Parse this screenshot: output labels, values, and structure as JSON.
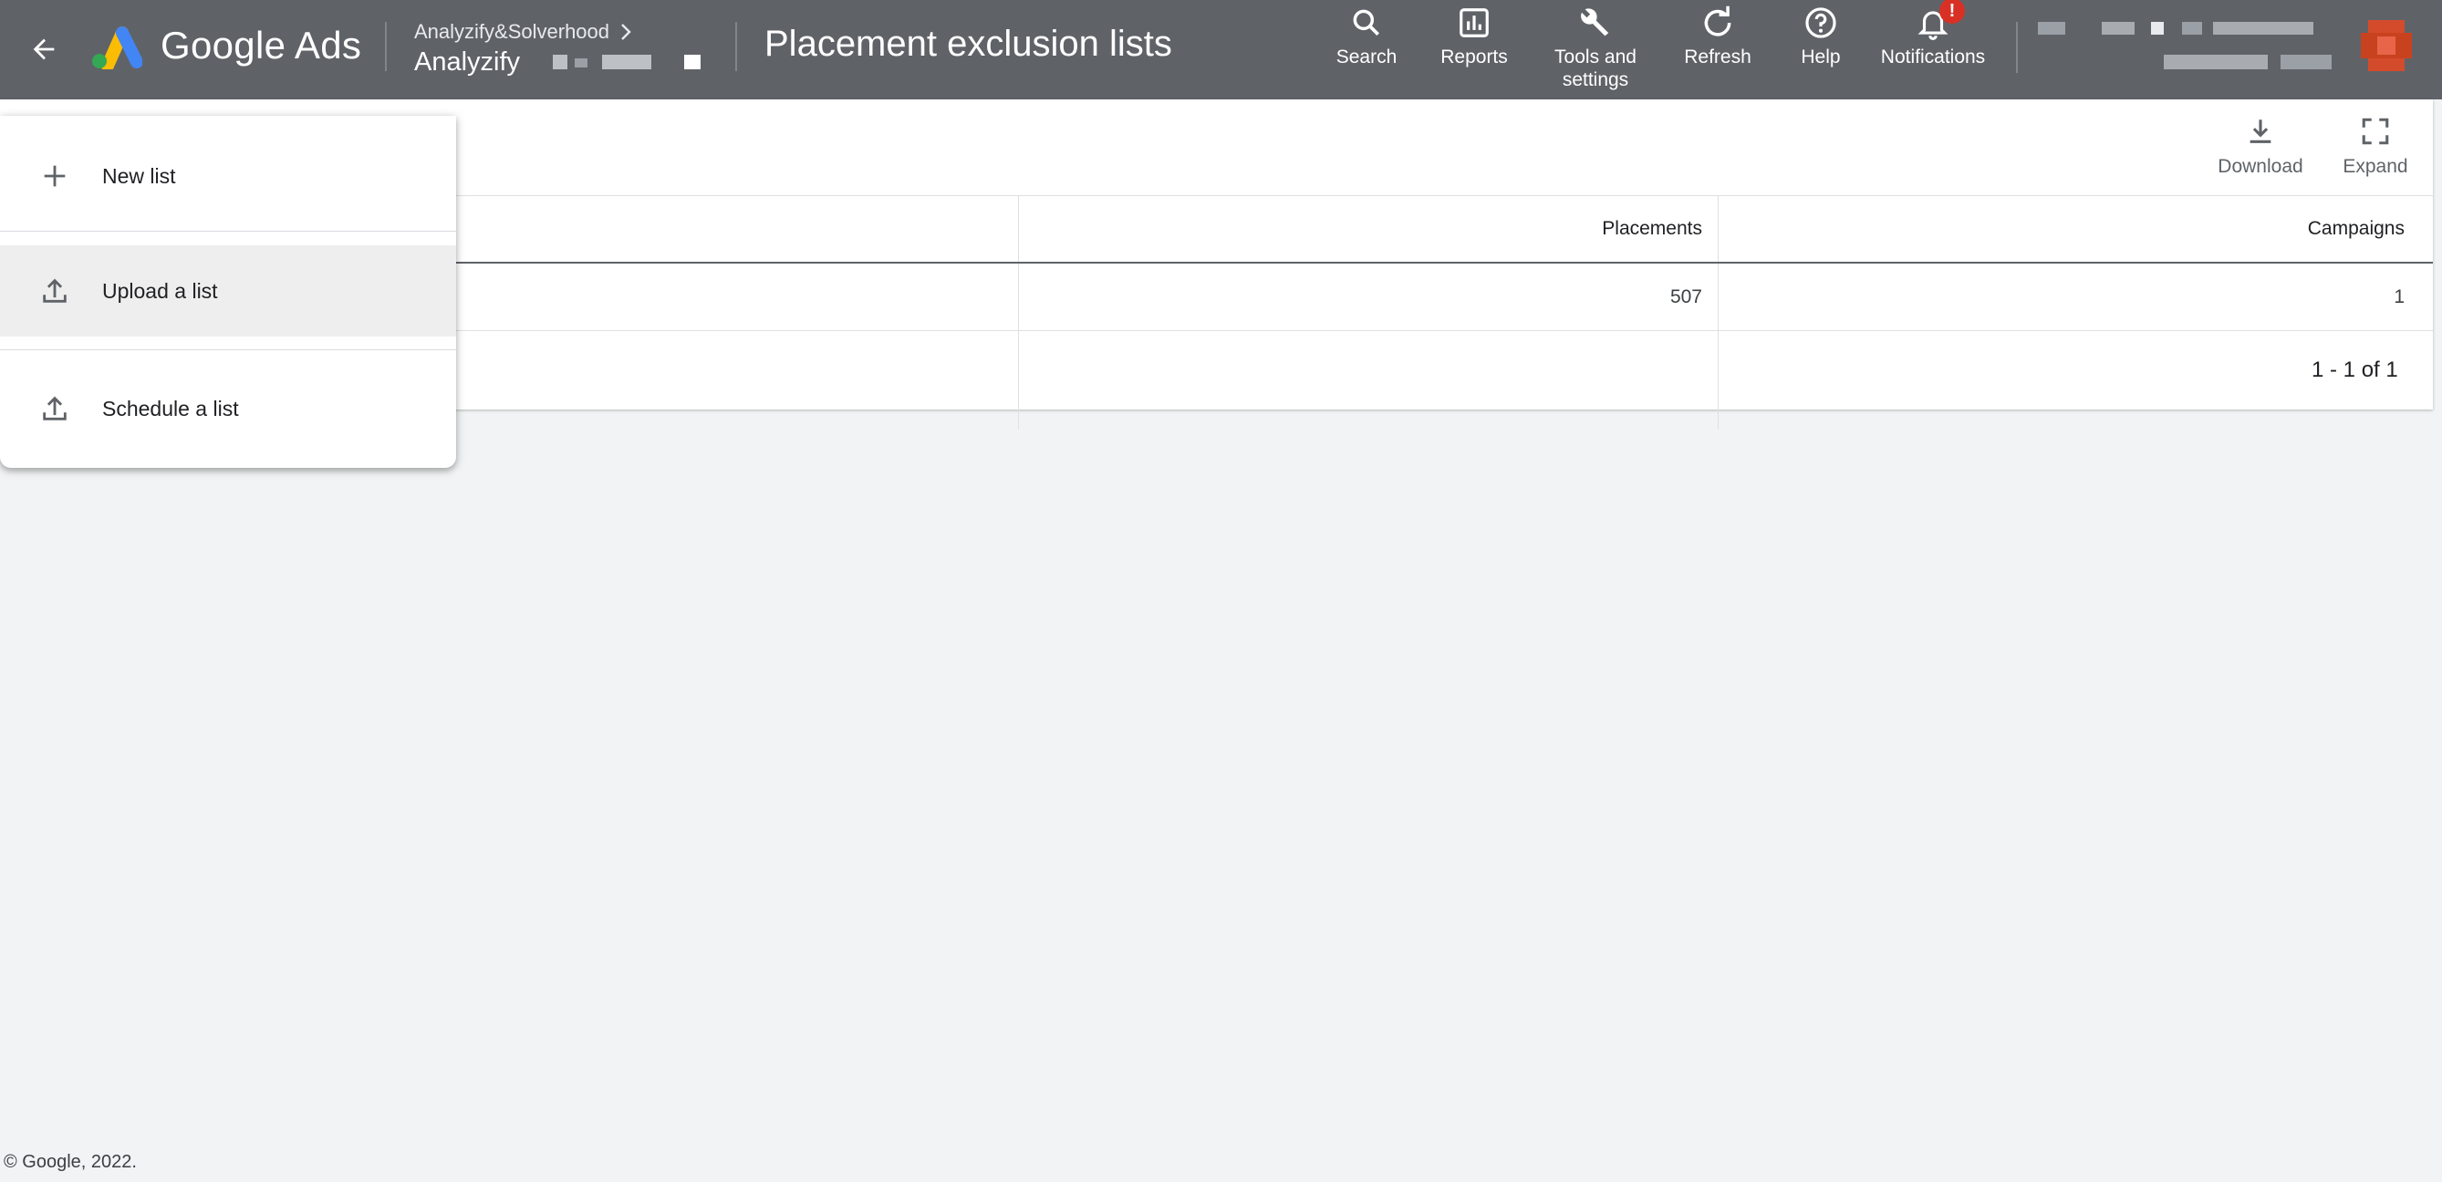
{
  "header": {
    "brand": "Google Ads",
    "breadcrumb_parent": "Analyzify&Solverhood",
    "account_name": "Analyzify",
    "page_title": "Placement exclusion lists",
    "tools": [
      {
        "label": "Search",
        "icon": "search-icon"
      },
      {
        "label": "Reports",
        "icon": "reports-icon"
      },
      {
        "label": "Tools and settings",
        "icon": "wrench-icon"
      },
      {
        "label": "Refresh",
        "icon": "refresh-icon"
      },
      {
        "label": "Help",
        "icon": "help-icon"
      },
      {
        "label": "Notifications",
        "icon": "bell-icon"
      }
    ],
    "notification_badge": "!"
  },
  "table_toolbar": {
    "download_label": "Download",
    "expand_label": "Expand"
  },
  "table": {
    "columns": [
      "Placements",
      "Campaigns"
    ],
    "rows": [
      {
        "placements": "507",
        "campaigns": "1"
      }
    ],
    "pagination": "1 - 1 of 1"
  },
  "menu": {
    "items": [
      {
        "label": "New list",
        "icon": "plus-icon"
      },
      {
        "label": "Upload a list",
        "icon": "upload-icon",
        "highlighted": true
      },
      {
        "label": "Schedule a list",
        "icon": "upload-icon"
      }
    ]
  },
  "footer": {
    "copyright": "© Google, 2022."
  },
  "colors": {
    "topbar": "#5f6368",
    "background": "#f1f3f4",
    "badge": "#d93025"
  }
}
